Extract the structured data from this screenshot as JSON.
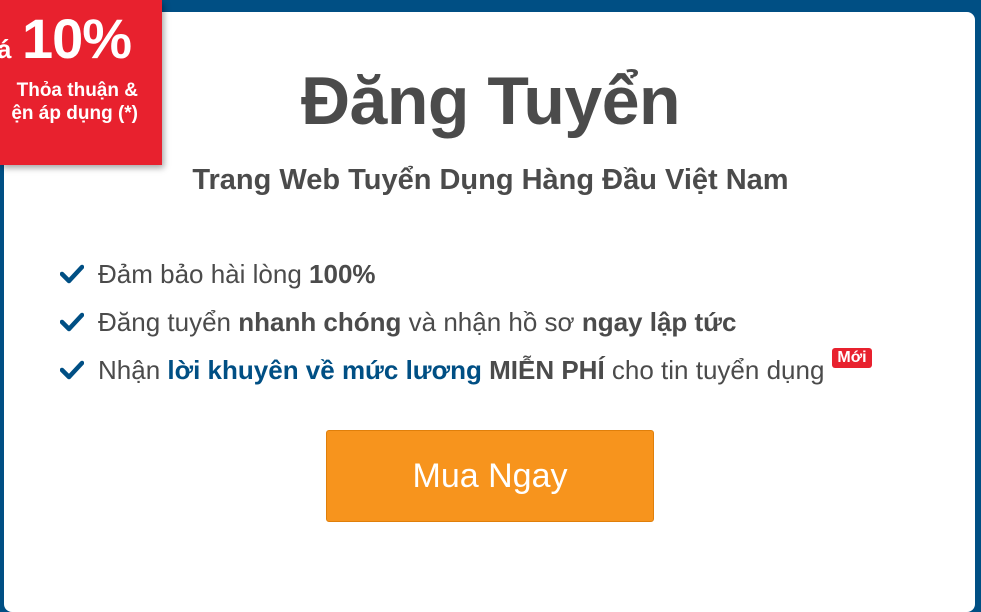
{
  "promo": {
    "prefix": "á",
    "percent": "10%",
    "terms_line1": "Thỏa thuận &",
    "terms_line2": "ện áp dụng (*)",
    "color": "#e8212e"
  },
  "header": {
    "title": "Đăng Tuyển",
    "subtitle": "Trang Web Tuyển Dụng Hàng Đầu Việt Nam"
  },
  "features": [
    {
      "icon": "check-icon",
      "parts": [
        "Đảm bảo hài lòng ",
        "100%"
      ]
    },
    {
      "icon": "check-icon",
      "parts": [
        "Đăng tuyển ",
        "nhanh chóng",
        " và nhận hồ sơ ",
        "ngay lập tức"
      ]
    },
    {
      "icon": "check-icon",
      "parts": [
        "Nhận ",
        "lời khuyên về mức lương",
        " ",
        "MIỄN PHÍ",
        " cho tin tuyển dụng"
      ],
      "badge": "Mới"
    }
  ],
  "cta": {
    "label": "Mua Ngay",
    "color": "#f7941d"
  },
  "colors": {
    "frame": "#004f84",
    "text": "#4b4b4b",
    "accent_blue": "#004f84"
  }
}
